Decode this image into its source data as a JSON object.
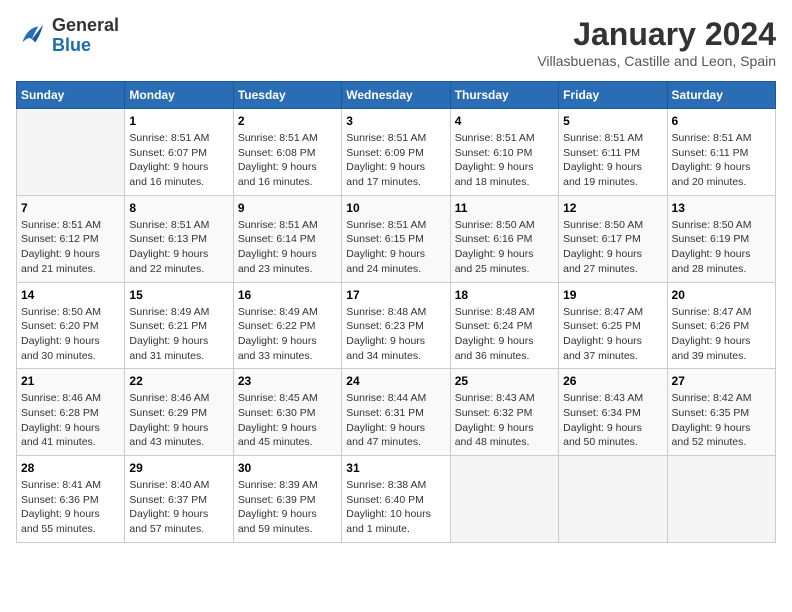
{
  "logo": {
    "line1": "General",
    "line2": "Blue"
  },
  "title": "January 2024",
  "location": "Villasbuenas, Castille and Leon, Spain",
  "weekdays": [
    "Sunday",
    "Monday",
    "Tuesday",
    "Wednesday",
    "Thursday",
    "Friday",
    "Saturday"
  ],
  "weeks": [
    [
      {
        "day": "",
        "sunrise": "",
        "sunset": "",
        "daylight": ""
      },
      {
        "day": "1",
        "sunrise": "Sunrise: 8:51 AM",
        "sunset": "Sunset: 6:07 PM",
        "daylight": "Daylight: 9 hours and 16 minutes."
      },
      {
        "day": "2",
        "sunrise": "Sunrise: 8:51 AM",
        "sunset": "Sunset: 6:08 PM",
        "daylight": "Daylight: 9 hours and 16 minutes."
      },
      {
        "day": "3",
        "sunrise": "Sunrise: 8:51 AM",
        "sunset": "Sunset: 6:09 PM",
        "daylight": "Daylight: 9 hours and 17 minutes."
      },
      {
        "day": "4",
        "sunrise": "Sunrise: 8:51 AM",
        "sunset": "Sunset: 6:10 PM",
        "daylight": "Daylight: 9 hours and 18 minutes."
      },
      {
        "day": "5",
        "sunrise": "Sunrise: 8:51 AM",
        "sunset": "Sunset: 6:11 PM",
        "daylight": "Daylight: 9 hours and 19 minutes."
      },
      {
        "day": "6",
        "sunrise": "Sunrise: 8:51 AM",
        "sunset": "Sunset: 6:11 PM",
        "daylight": "Daylight: 9 hours and 20 minutes."
      }
    ],
    [
      {
        "day": "7",
        "sunrise": "Sunrise: 8:51 AM",
        "sunset": "Sunset: 6:12 PM",
        "daylight": "Daylight: 9 hours and 21 minutes."
      },
      {
        "day": "8",
        "sunrise": "Sunrise: 8:51 AM",
        "sunset": "Sunset: 6:13 PM",
        "daylight": "Daylight: 9 hours and 22 minutes."
      },
      {
        "day": "9",
        "sunrise": "Sunrise: 8:51 AM",
        "sunset": "Sunset: 6:14 PM",
        "daylight": "Daylight: 9 hours and 23 minutes."
      },
      {
        "day": "10",
        "sunrise": "Sunrise: 8:51 AM",
        "sunset": "Sunset: 6:15 PM",
        "daylight": "Daylight: 9 hours and 24 minutes."
      },
      {
        "day": "11",
        "sunrise": "Sunrise: 8:50 AM",
        "sunset": "Sunset: 6:16 PM",
        "daylight": "Daylight: 9 hours and 25 minutes."
      },
      {
        "day": "12",
        "sunrise": "Sunrise: 8:50 AM",
        "sunset": "Sunset: 6:17 PM",
        "daylight": "Daylight: 9 hours and 27 minutes."
      },
      {
        "day": "13",
        "sunrise": "Sunrise: 8:50 AM",
        "sunset": "Sunset: 6:19 PM",
        "daylight": "Daylight: 9 hours and 28 minutes."
      }
    ],
    [
      {
        "day": "14",
        "sunrise": "Sunrise: 8:50 AM",
        "sunset": "Sunset: 6:20 PM",
        "daylight": "Daylight: 9 hours and 30 minutes."
      },
      {
        "day": "15",
        "sunrise": "Sunrise: 8:49 AM",
        "sunset": "Sunset: 6:21 PM",
        "daylight": "Daylight: 9 hours and 31 minutes."
      },
      {
        "day": "16",
        "sunrise": "Sunrise: 8:49 AM",
        "sunset": "Sunset: 6:22 PM",
        "daylight": "Daylight: 9 hours and 33 minutes."
      },
      {
        "day": "17",
        "sunrise": "Sunrise: 8:48 AM",
        "sunset": "Sunset: 6:23 PM",
        "daylight": "Daylight: 9 hours and 34 minutes."
      },
      {
        "day": "18",
        "sunrise": "Sunrise: 8:48 AM",
        "sunset": "Sunset: 6:24 PM",
        "daylight": "Daylight: 9 hours and 36 minutes."
      },
      {
        "day": "19",
        "sunrise": "Sunrise: 8:47 AM",
        "sunset": "Sunset: 6:25 PM",
        "daylight": "Daylight: 9 hours and 37 minutes."
      },
      {
        "day": "20",
        "sunrise": "Sunrise: 8:47 AM",
        "sunset": "Sunset: 6:26 PM",
        "daylight": "Daylight: 9 hours and 39 minutes."
      }
    ],
    [
      {
        "day": "21",
        "sunrise": "Sunrise: 8:46 AM",
        "sunset": "Sunset: 6:28 PM",
        "daylight": "Daylight: 9 hours and 41 minutes."
      },
      {
        "day": "22",
        "sunrise": "Sunrise: 8:46 AM",
        "sunset": "Sunset: 6:29 PM",
        "daylight": "Daylight: 9 hours and 43 minutes."
      },
      {
        "day": "23",
        "sunrise": "Sunrise: 8:45 AM",
        "sunset": "Sunset: 6:30 PM",
        "daylight": "Daylight: 9 hours and 45 minutes."
      },
      {
        "day": "24",
        "sunrise": "Sunrise: 8:44 AM",
        "sunset": "Sunset: 6:31 PM",
        "daylight": "Daylight: 9 hours and 47 minutes."
      },
      {
        "day": "25",
        "sunrise": "Sunrise: 8:43 AM",
        "sunset": "Sunset: 6:32 PM",
        "daylight": "Daylight: 9 hours and 48 minutes."
      },
      {
        "day": "26",
        "sunrise": "Sunrise: 8:43 AM",
        "sunset": "Sunset: 6:34 PM",
        "daylight": "Daylight: 9 hours and 50 minutes."
      },
      {
        "day": "27",
        "sunrise": "Sunrise: 8:42 AM",
        "sunset": "Sunset: 6:35 PM",
        "daylight": "Daylight: 9 hours and 52 minutes."
      }
    ],
    [
      {
        "day": "28",
        "sunrise": "Sunrise: 8:41 AM",
        "sunset": "Sunset: 6:36 PM",
        "daylight": "Daylight: 9 hours and 55 minutes."
      },
      {
        "day": "29",
        "sunrise": "Sunrise: 8:40 AM",
        "sunset": "Sunset: 6:37 PM",
        "daylight": "Daylight: 9 hours and 57 minutes."
      },
      {
        "day": "30",
        "sunrise": "Sunrise: 8:39 AM",
        "sunset": "Sunset: 6:39 PM",
        "daylight": "Daylight: 9 hours and 59 minutes."
      },
      {
        "day": "31",
        "sunrise": "Sunrise: 8:38 AM",
        "sunset": "Sunset: 6:40 PM",
        "daylight": "Daylight: 10 hours and 1 minute."
      },
      {
        "day": "",
        "sunrise": "",
        "sunset": "",
        "daylight": ""
      },
      {
        "day": "",
        "sunrise": "",
        "sunset": "",
        "daylight": ""
      },
      {
        "day": "",
        "sunrise": "",
        "sunset": "",
        "daylight": ""
      }
    ]
  ]
}
